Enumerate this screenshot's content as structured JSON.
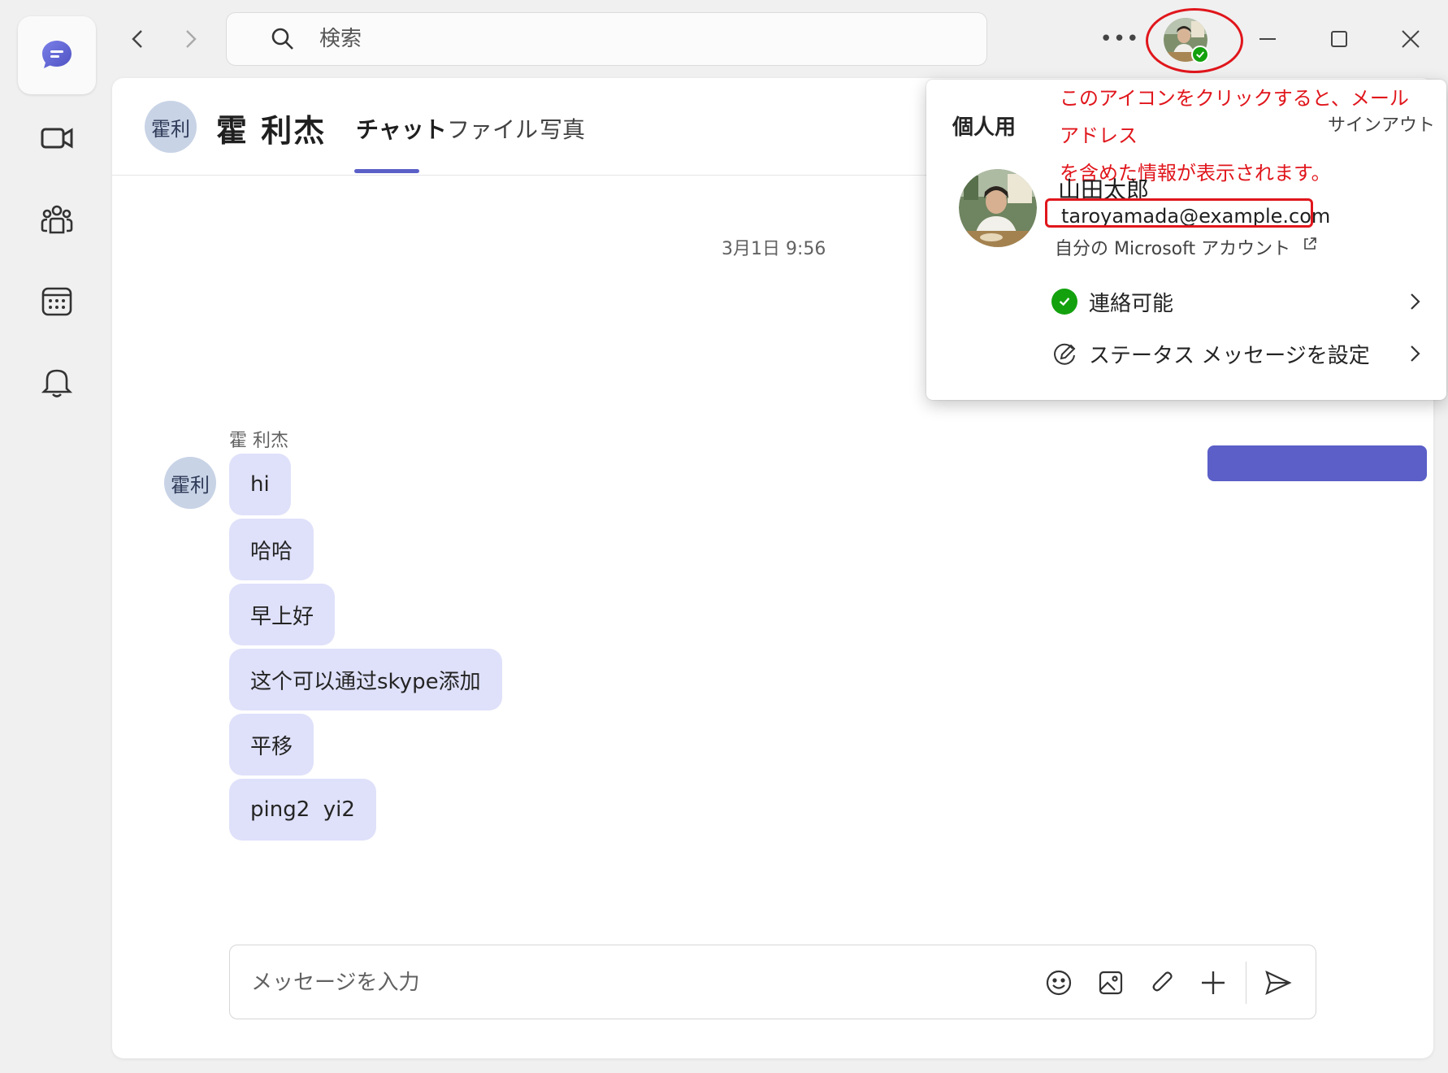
{
  "search": {
    "placeholder": "検索"
  },
  "chat": {
    "contact_initials": "霍利",
    "contact_name": "霍 利杰",
    "tabs": [
      {
        "label": "チャット"
      },
      {
        "label": "ファイル"
      },
      {
        "label": "写真"
      }
    ],
    "timestamp": "3月1日 9:56",
    "sender_name": "霍 利杰",
    "messages": [
      {
        "text": "hi"
      },
      {
        "text": "哈哈"
      },
      {
        "text": "早上好"
      },
      {
        "text": "这个可以通过skype添加"
      },
      {
        "text": "平移"
      },
      {
        "text": "ping2  yi2"
      }
    ],
    "compose_placeholder": "メッセージを入力"
  },
  "profile_panel": {
    "title": "個人用",
    "annotation_line1": "このアイコンをクリックすると、メールアドレス",
    "annotation_line2": "を含めた情報が表示されます。",
    "signout": "サインアウト",
    "user_name": "山田太郎",
    "email": "taroyamada@example.com",
    "ms_account": "自分の Microsoft アカウント",
    "status": "連絡可能",
    "status_message": "ステータス メッセージを設定"
  },
  "colors": {
    "accent": "#5b5fc7",
    "bubble": "#dfe1fa",
    "presence": "#13a10e",
    "annotation_red": "#e0161c"
  }
}
